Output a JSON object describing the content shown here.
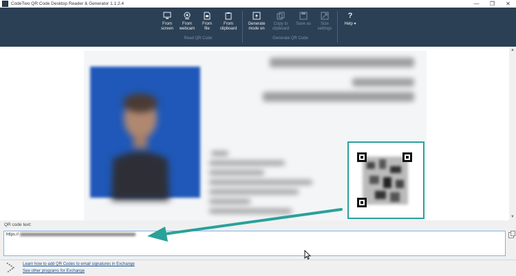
{
  "window": {
    "title": "CodeTwo QR Code Desktop Reader & Generator 1.1.2.4",
    "controls": {
      "minimize": "—",
      "maximize": "❐",
      "close": "✕"
    }
  },
  "ribbon": {
    "read_group": {
      "label": "Read QR Code",
      "buttons": [
        {
          "label1": "From",
          "label2": "screen",
          "icon": "screen-capture-icon"
        },
        {
          "label1": "From",
          "label2": "webcam",
          "icon": "webcam-icon"
        },
        {
          "label1": "From",
          "label2": "file",
          "icon": "file-icon"
        },
        {
          "label1": "From",
          "label2": "clipboard",
          "icon": "clipboard-icon"
        }
      ]
    },
    "generate_group": {
      "label": "Generate QR Code",
      "buttons": [
        {
          "label1": "Generate",
          "label2": "mode on",
          "icon": "generate-mode-icon"
        },
        {
          "label1": "Copy to",
          "label2": "clipboard",
          "icon": "copy-icon"
        },
        {
          "label1": "Save as",
          "label2": "",
          "icon": "save-icon"
        },
        {
          "label1": "Size",
          "label2": "settings",
          "icon": "size-settings-icon"
        }
      ]
    },
    "help": {
      "label": "Help ▾",
      "icon": "help-icon"
    }
  },
  "bottom_panel": {
    "qr_label": "QR code text:",
    "qr_text_prefix": "https://",
    "links": [
      "Learn how to add QR Codes to email signatures in Exchange",
      "See other programs for Exchange"
    ]
  },
  "colors": {
    "ribbon_bg": "#2c4055",
    "annotation_teal": "#2aa19a",
    "link": "#1a4d8c"
  }
}
